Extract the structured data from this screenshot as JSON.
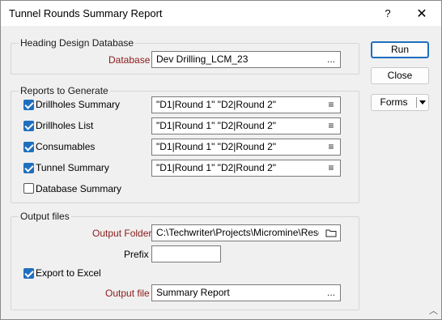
{
  "window": {
    "title": "Tunnel Rounds Summary Report",
    "help_label": "?",
    "close_label": "✕"
  },
  "heading_group": {
    "title": "Heading Design Database",
    "database_label": "Database",
    "database_value": "Dev Drilling_LCM_23",
    "browse_label": "..."
  },
  "reports_group": {
    "title": "Reports to Generate",
    "items": [
      {
        "label": "Drillholes Summary",
        "checked": true,
        "value": "\"D1|Round 1\" \"D2|Round 2\""
      },
      {
        "label": "Drillholes List",
        "checked": true,
        "value": "\"D1|Round 1\" \"D2|Round 2\""
      },
      {
        "label": "Consumables",
        "checked": true,
        "value": "\"D1|Round 1\" \"D2|Round 2\""
      },
      {
        "label": "Tunnel Summary",
        "checked": true,
        "value": "\"D1|Round 1\" \"D2|Round 2\""
      },
      {
        "label": "Database Summary",
        "checked": false
      }
    ],
    "list_icon": "≡"
  },
  "output_group": {
    "title": "Output files",
    "output_folder_label": "Output Folder",
    "output_folder_value": "C:\\Techwriter\\Projects\\Micromine\\Resources",
    "prefix_label": "Prefix",
    "prefix_value": "",
    "export_label": "Export to Excel",
    "export_checked": true,
    "output_file_label": "Output file",
    "output_file_value": "Summary Report",
    "browse_label": "..."
  },
  "buttons": {
    "run": "Run",
    "close": "Close",
    "forms": "Forms"
  },
  "colors": {
    "accent": "#1f6fbf",
    "required_label": "#8b1a1a",
    "dialog_bg": "#f0f0f0"
  }
}
